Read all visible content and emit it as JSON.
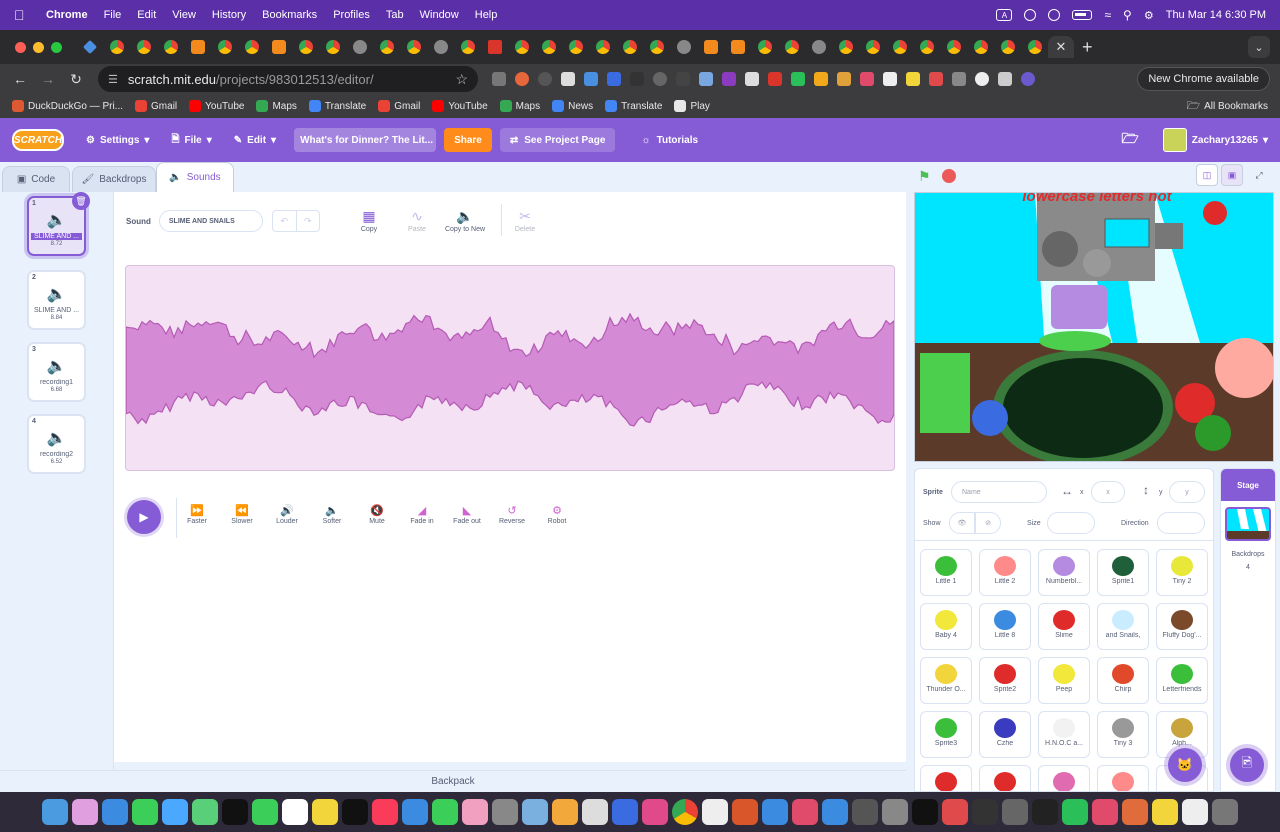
{
  "macos": {
    "app_name": "Chrome",
    "menus": [
      "File",
      "Edit",
      "View",
      "History",
      "Bookmarks",
      "Profiles",
      "Tab",
      "Window",
      "Help"
    ],
    "input_source": "A",
    "datetime": "Thu Mar 14  6:30 PM"
  },
  "browser": {
    "url_host": "scratch.mit.edu",
    "url_path": "/projects/983012513/editor/",
    "new_chrome": "New Chrome available",
    "bookmarks": [
      {
        "label": "DuckDuckGo — Pri...",
        "color": "#de5833"
      },
      {
        "label": "Gmail",
        "color": "#ea4335"
      },
      {
        "label": "YouTube",
        "color": "#ff0000"
      },
      {
        "label": "Maps",
        "color": "#34a853"
      },
      {
        "label": "Translate",
        "color": "#4285f4"
      },
      {
        "label": "Gmail",
        "color": "#ea4335"
      },
      {
        "label": "YouTube",
        "color": "#ff0000"
      },
      {
        "label": "Maps",
        "color": "#34a853"
      },
      {
        "label": "News",
        "color": "#4285f4"
      },
      {
        "label": "Translate",
        "color": "#4285f4"
      },
      {
        "label": "Play",
        "color": "#e8e8e8"
      }
    ],
    "all_bookmarks": "All Bookmarks"
  },
  "scratch": {
    "logo": "SCRATCH",
    "menu": {
      "settings": "Settings",
      "file": "File",
      "edit": "Edit"
    },
    "project_title": "What's for Dinner? The Lit...",
    "share": "Share",
    "see_project": "See Project Page",
    "tutorials": "Tutorials",
    "username": "Zachary13265",
    "tabs": {
      "code": "Code",
      "backdrops": "Backdrops",
      "sounds": "Sounds"
    },
    "sounds": [
      {
        "num": "1",
        "name": "SLIME AND ...",
        "duration": "8.72"
      },
      {
        "num": "2",
        "name": "SLIME AND ...",
        "duration": "8.84"
      },
      {
        "num": "3",
        "name": "recording1",
        "duration": "6.68"
      },
      {
        "num": "4",
        "name": "recording2",
        "duration": "6.52"
      }
    ],
    "editor": {
      "sound_label": "Sound",
      "sound_name": "SLIME AND SNAILS",
      "tools": [
        "Copy",
        "Paste",
        "Copy to New",
        "Delete"
      ],
      "effects": [
        "Faster",
        "Slower",
        "Louder",
        "Softer",
        "Mute",
        "Fade in",
        "Fade out",
        "Reverse",
        "Robot"
      ]
    },
    "backpack": "Backpack",
    "stage_text": "lowercase letters not",
    "sprite_info": {
      "sprite_label": "Sprite",
      "name_placeholder": "Name",
      "x_label": "x",
      "x_placeholder": "x",
      "y_label": "y",
      "y_placeholder": "y",
      "show_label": "Show",
      "size_label": "Size",
      "direction_label": "Direction"
    },
    "sprites": [
      {
        "name": "Little 1",
        "color": "#3bbf3b"
      },
      {
        "name": "Little 2",
        "color": "#ff8a8a"
      },
      {
        "name": "Numberbl...",
        "color": "#b48be0"
      },
      {
        "name": "Sprite1",
        "color": "#1f5f3a"
      },
      {
        "name": "Tiny 2",
        "color": "#e8e83b"
      },
      {
        "name": "Baby 4",
        "color": "#f2e83b"
      },
      {
        "name": "Little 8",
        "color": "#3b8be0"
      },
      {
        "name": "Slime",
        "color": "#e02b2b"
      },
      {
        "name": "and Snails,",
        "color": "#c9ecff"
      },
      {
        "name": "Fluffy Dog'...",
        "color": "#7a4a2a"
      },
      {
        "name": "Thunder O...",
        "color": "#f2d43b"
      },
      {
        "name": "Sprite2",
        "color": "#e02b2b"
      },
      {
        "name": "Peep",
        "color": "#f2e83b"
      },
      {
        "name": "Chirp",
        "color": "#e04a2b"
      },
      {
        "name": "Letterfriends",
        "color": "#3bbf3b"
      },
      {
        "name": "Sprite3",
        "color": "#3bbf3b"
      },
      {
        "name": "Czhe",
        "color": "#3b3bbf"
      },
      {
        "name": "H.N.O.C a...",
        "color": "#f2f2f2"
      },
      {
        "name": "Tiny 3",
        "color": "#999999"
      },
      {
        "name": "Alph...",
        "color": "#c9a33b"
      }
    ],
    "stage_panel": {
      "header": "Stage",
      "backdrops_label": "Backdrops",
      "backdrops_count": "4"
    }
  },
  "colors": {
    "scratch_purple": "#855cd6",
    "wave_fill": "#d48ad4",
    "wave_stroke": "#b55ab5",
    "stage_bg": "#00e5ff"
  }
}
